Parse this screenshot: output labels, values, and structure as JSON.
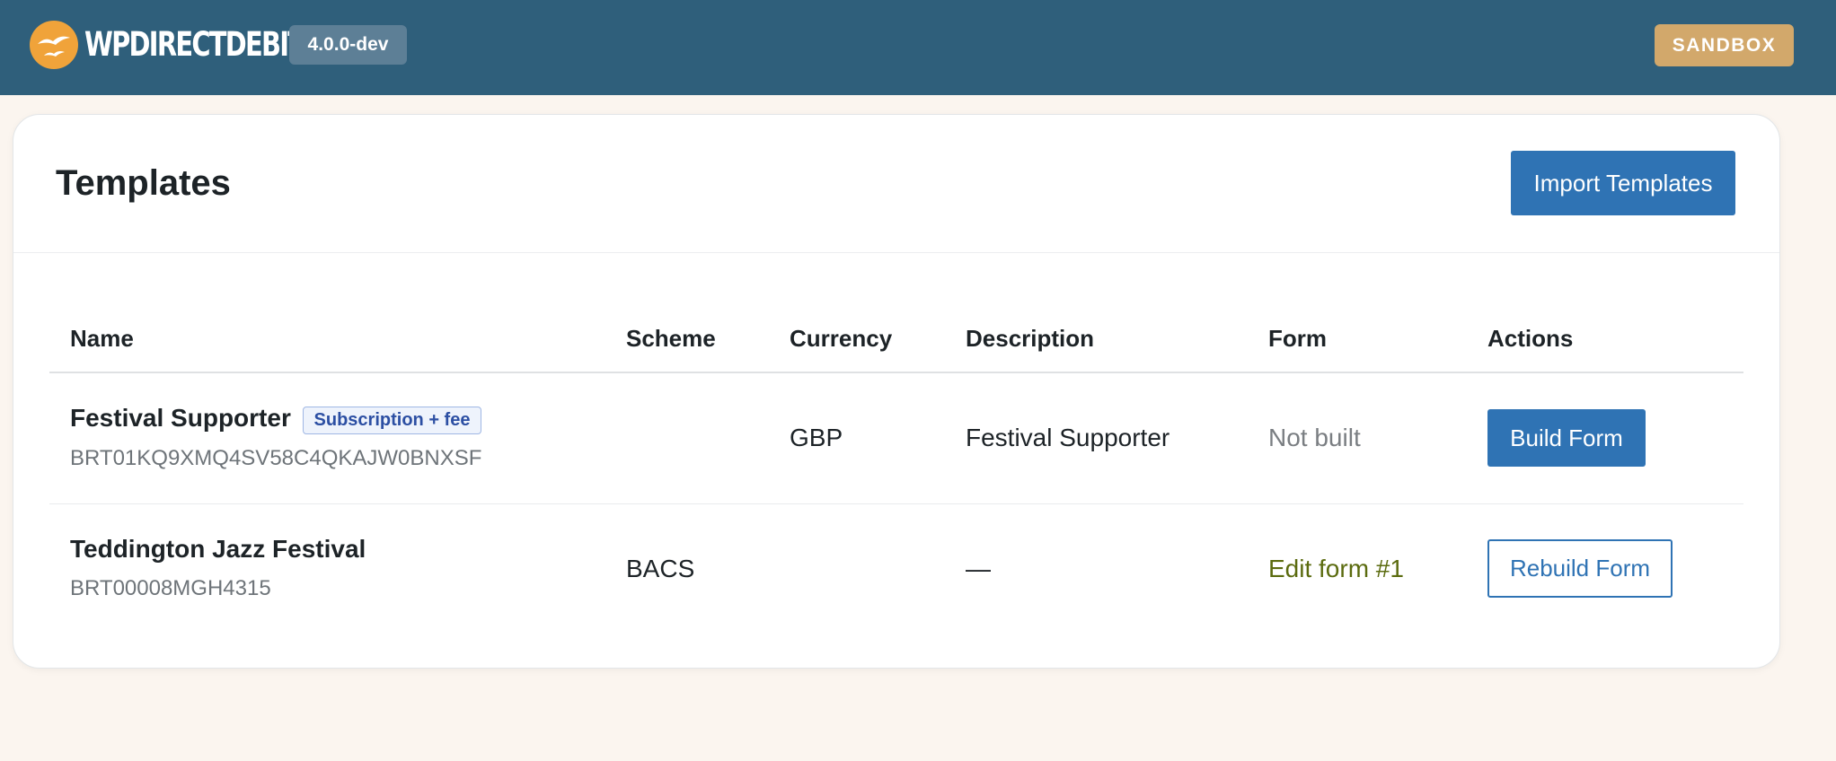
{
  "header": {
    "brand": "WPDIRECTDEBIT",
    "version": "4.0.0-dev",
    "environment": "SANDBOX",
    "background_color": "#2f5f7b",
    "logo_color": "#f0a33a"
  },
  "page": {
    "title": "Templates",
    "import_button_label": "Import Templates",
    "accent_color": "#2f73b4"
  },
  "table": {
    "columns": [
      "Name",
      "Scheme",
      "Currency",
      "Description",
      "Form",
      "Actions"
    ],
    "rows": [
      {
        "name": "Festival Supporter",
        "badge": "Subscription + fee",
        "code": "BRT01KQ9XMQ4SV58C4QKAJW0BNXSF",
        "scheme": "",
        "currency": "GBP",
        "description": "Festival Supporter",
        "form": "Not built",
        "action": "Build Form"
      },
      {
        "name": "Teddington Jazz Festival",
        "code": "BRT00008MGH4315",
        "scheme": "BACS",
        "currency": "",
        "description": "—",
        "form": "Edit form #1",
        "action": "Rebuild Form"
      }
    ]
  }
}
